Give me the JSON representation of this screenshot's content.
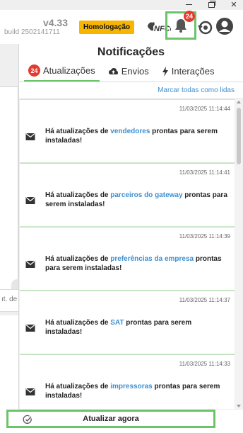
{
  "app": {
    "version": "v4.33",
    "build": "build 2502141711",
    "environment": "Homologação",
    "nfce_logo_text": "NFCe"
  },
  "notifications": {
    "badge_count": "24",
    "title": "Notificações",
    "tabs": [
      {
        "label": "Atualizações",
        "badge": "24",
        "icon": "refresh-icon",
        "active": true
      },
      {
        "label": "Envios",
        "icon": "cloud-upload-icon"
      },
      {
        "label": "Interações",
        "icon": "lightning-icon"
      }
    ],
    "mark_all_label": "Marcar todas como lidas",
    "items": [
      {
        "time": "11/03/2025 11:14:44",
        "prefix": "Há atualizações de ",
        "subject": "vendedores",
        "suffix": " prontas para serem instaladas!"
      },
      {
        "time": "11/03/2025 11:14:41",
        "prefix": "Há atualizações de ",
        "subject": "parceiros do gateway",
        "suffix": " prontas para serem instaladas!"
      },
      {
        "time": "11/03/2025 11:14:39",
        "prefix": "Há atualizações de ",
        "subject": "preferências da empresa",
        "suffix": " prontas para serem instaladas!"
      },
      {
        "time": "11/03/2025 11:14:37",
        "prefix": "Há atualizações de ",
        "subject": "SAT",
        "suffix": " prontas para serem instaladas!"
      },
      {
        "time": "11/03/2025 11:14:33",
        "prefix": "Há atualizações de ",
        "subject": "impressoras",
        "suffix": " prontas para serem instaladas!"
      }
    ],
    "update_now_label": "Atualizar agora"
  },
  "background": {
    "input_fragment": "ıt. de"
  },
  "colors": {
    "accent_green": "#6cc36a",
    "badge_red": "#e23b30",
    "link_blue": "#3d8fd0",
    "env_yellow": "#f7b500"
  }
}
